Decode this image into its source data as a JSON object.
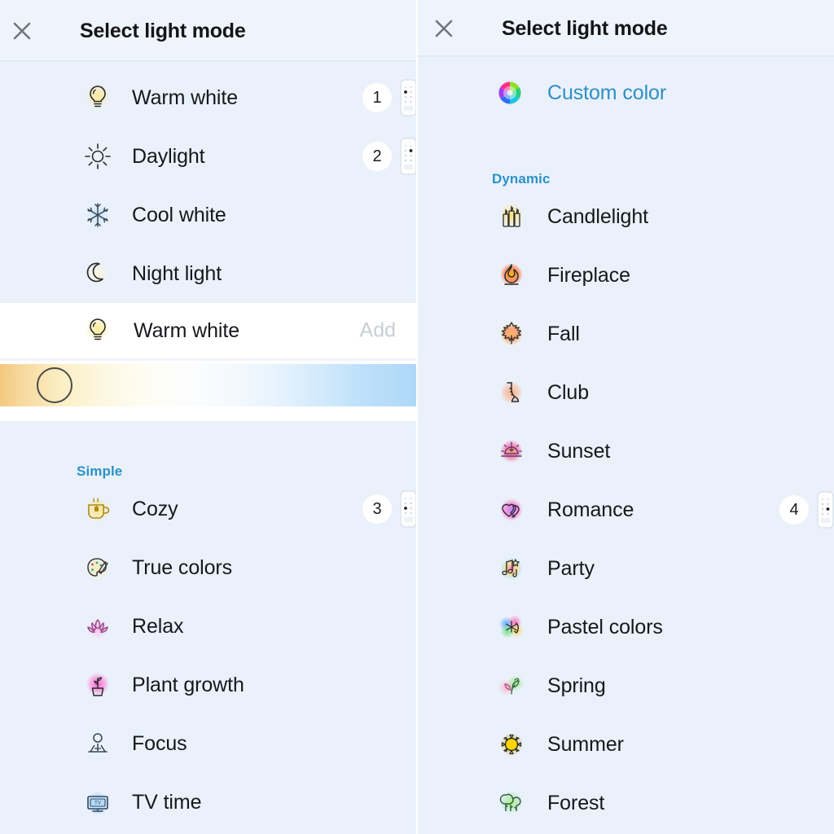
{
  "left_panel": {
    "header": {
      "title": "Select light mode",
      "close_icon": "close-icon"
    },
    "top_items": [
      {
        "label": "Warm white",
        "icon": "lightbulb-icon",
        "badge": "1",
        "remote": true
      },
      {
        "label": "Daylight",
        "icon": "sun-icon",
        "badge": "2",
        "remote": true
      },
      {
        "label": "Cool white",
        "icon": "snowflake-icon",
        "badge": "",
        "remote": false
      },
      {
        "label": "Night light",
        "icon": "moon-icon",
        "badge": "",
        "remote": false
      }
    ],
    "selected_card": {
      "label": "Warm white",
      "icon": "lightbulb-icon",
      "add_label": "Add",
      "slider": {
        "name": "color-temperature-slider",
        "handle_position_percent": 13,
        "gradient_from": "#f3c87e",
        "gradient_mid": "#fefcf0",
        "gradient_to": "#aed8f7"
      }
    },
    "section_label": "Simple",
    "simple_items": [
      {
        "label": "Cozy",
        "icon": "tea-cup-icon",
        "badge": "3",
        "remote": true
      },
      {
        "label": "True colors",
        "icon": "palette-icon",
        "badge": "",
        "remote": false
      },
      {
        "label": "Relax",
        "icon": "lotus-icon",
        "badge": "",
        "remote": false
      },
      {
        "label": "Plant growth",
        "icon": "potted-plant-icon",
        "badge": "",
        "remote": false
      },
      {
        "label": "Focus",
        "icon": "person-desk-icon",
        "badge": "",
        "remote": false
      },
      {
        "label": "TV time",
        "icon": "television-icon",
        "badge": "",
        "remote": false
      }
    ]
  },
  "right_panel": {
    "header": {
      "title": "Select light mode",
      "close_icon": "close-icon"
    },
    "custom_color": {
      "label": "Custom color",
      "icon": "color-wheel-icon",
      "color": "#2e8fc4"
    },
    "section_label": "Dynamic",
    "dynamic_items": [
      {
        "label": "Candlelight",
        "icon": "candles-icon",
        "badge": "",
        "remote": false
      },
      {
        "label": "Fireplace",
        "icon": "flame-icon",
        "badge": "",
        "remote": false
      },
      {
        "label": "Fall",
        "icon": "maple-leaf-icon",
        "badge": "",
        "remote": false
      },
      {
        "label": "Club",
        "icon": "saxophone-icon",
        "badge": "",
        "remote": false
      },
      {
        "label": "Sunset",
        "icon": "sunset-icon",
        "badge": "",
        "remote": false
      },
      {
        "label": "Romance",
        "icon": "two-hearts-icon",
        "badge": "4",
        "remote": true
      },
      {
        "label": "Party",
        "icon": "music-notes-icon",
        "badge": "",
        "remote": false
      },
      {
        "label": "Pastel colors",
        "icon": "color-splash-icon",
        "badge": "",
        "remote": false
      },
      {
        "label": "Spring",
        "icon": "sprout-icon",
        "badge": "",
        "remote": false
      },
      {
        "label": "Summer",
        "icon": "sun-bright-icon",
        "badge": "",
        "remote": false
      },
      {
        "label": "Forest",
        "icon": "trees-icon",
        "badge": "",
        "remote": false
      }
    ]
  },
  "colors": {
    "background": "#eaf1fa",
    "header_bg": "#eef4fb",
    "accent_blue": "#2a92c6",
    "text": "#16181b",
    "muted": "#c9ced4"
  }
}
